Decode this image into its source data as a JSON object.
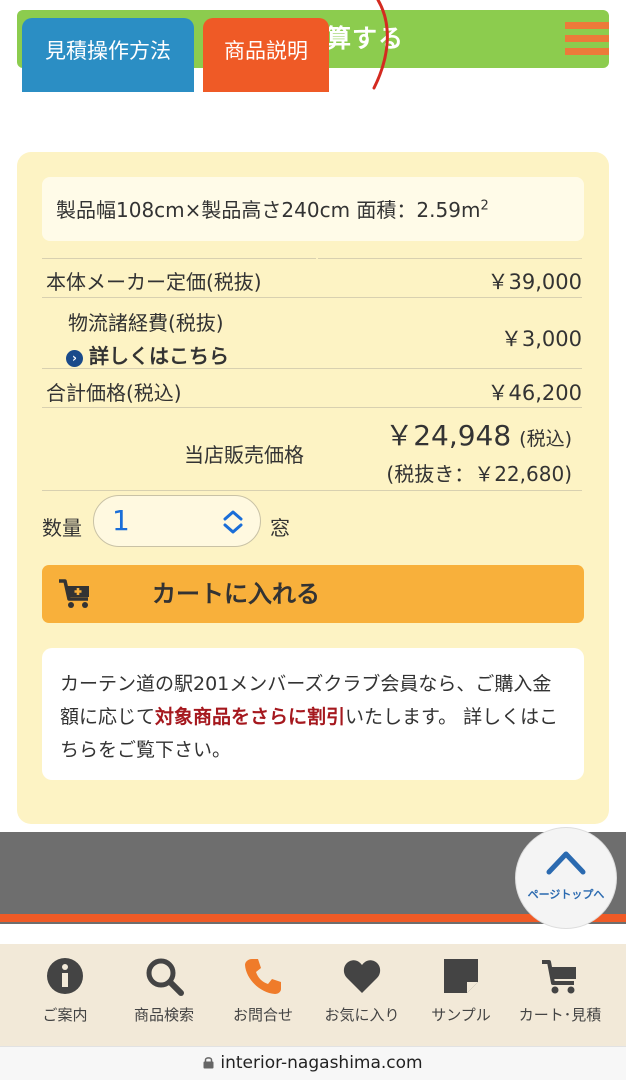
{
  "calc_bar": {
    "title": "価格を試算する"
  },
  "dimensions": {
    "text": "製品幅108cm×製品高さ240cm 面積：2.59m",
    "sup": "2"
  },
  "price_rows": {
    "list_price_label": "本体メーカー定価(税抜)",
    "list_price_value": "￥39,000",
    "logistics_label": "物流諸経費(税抜)",
    "logistics_link": "詳しくはこちら",
    "logistics_value": "￥3,000",
    "total_label": "合計価格(税込)",
    "total_value": "￥46,200",
    "store_price_label": "当店販売価格",
    "store_price_value": "￥24,948",
    "store_price_tax": "(税込)",
    "store_price_excl": "(税抜き：￥22,680)"
  },
  "quantity": {
    "label": "数量",
    "value": "1",
    "unit": "窓"
  },
  "cart_button": {
    "label": "カートに入れる"
  },
  "member_note": {
    "part1": "カーテン道の駅201メンバーズクラブ会員なら、ご購入金額に応じて",
    "highlight": "対象商品をさらに割引",
    "part2": "いたします。 詳しくはこちらをご覧下さい。"
  },
  "tabs": [
    {
      "label": "見積操作方法"
    },
    {
      "label": "商品説明"
    }
  ],
  "page_top": {
    "label": "ページトップへ"
  },
  "bottom_nav": [
    {
      "label": "ご案内",
      "icon": "info-icon"
    },
    {
      "label": "商品検索",
      "icon": "search-icon"
    },
    {
      "label": "お問合せ",
      "icon": "phone-icon"
    },
    {
      "label": "お気に入り",
      "icon": "heart-icon"
    },
    {
      "label": "サンプル",
      "icon": "sample-icon"
    },
    {
      "label": "カート･見積",
      "icon": "cart-icon"
    }
  ],
  "url_bar": {
    "url": "interior-nagashima.com"
  },
  "colors": {
    "calc_bar": "#8ccc4e",
    "panel": "#fdf3c4",
    "cart_button": "#f8b03b",
    "price_red": "#d02a1e",
    "tab_blue": "#2b8ec4",
    "tab_orange": "#ef5a26"
  }
}
